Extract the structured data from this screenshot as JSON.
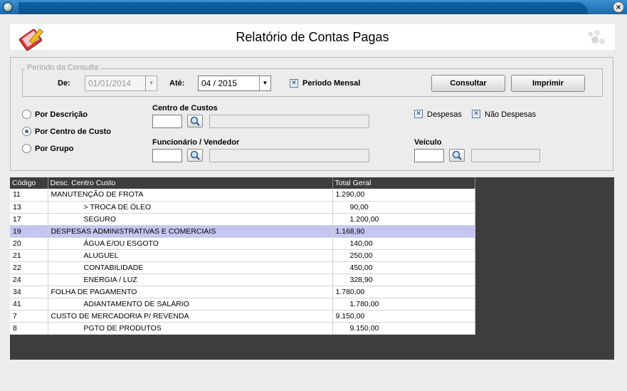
{
  "header": {
    "title": "Relatório de Contas Pagas"
  },
  "periodo": {
    "legend": "Período da Consulta",
    "de_label": "De:",
    "de_value": "01/01/2014",
    "ate_label": "Até:",
    "ate_value": "04 / 2015",
    "mensal_label": "Período Mensal",
    "consultar_label": "Consultar",
    "imprimir_label": "Imprimir"
  },
  "options": {
    "por_descricao": "Por Descrição",
    "por_centro": "Por Centro de Custo",
    "por_grupo": "Por Grupo",
    "selected": "por_centro"
  },
  "filters": {
    "centro_label": "Centro de Custos",
    "funcionario_label": "Funcionário / Vendedor",
    "despesas_label": "Despesas",
    "nao_despesas_label": "Não Despesas",
    "veiculo_label": "Veículo"
  },
  "grid": {
    "columns": [
      "Código",
      "Desc. Centro Custo",
      "Total Geral"
    ],
    "rows": [
      {
        "code": "11",
        "desc": "MANUTENÇÃO DE FROTA",
        "total": "1.290,00",
        "level": 0
      },
      {
        "code": "13",
        "desc": "> TROCA DE ÓLEO",
        "total": "90,00",
        "level": 1
      },
      {
        "code": "17",
        "desc": "SEGURO",
        "total": "1.200,00",
        "level": 1
      },
      {
        "code": "19",
        "desc": "DESPESAS ADMINISTRATIVAS E COMERCIAIS",
        "total": "1.168,90",
        "level": 0,
        "selected": true
      },
      {
        "code": "20",
        "desc": "ÁGUA E/OU ESGOTO",
        "total": "140,00",
        "level": 1
      },
      {
        "code": "21",
        "desc": "ALUGUEL",
        "total": "250,00",
        "level": 1
      },
      {
        "code": "22",
        "desc": "CONTABILIDADE",
        "total": "450,00",
        "level": 1
      },
      {
        "code": "24",
        "desc": "ENERGIA / LUZ",
        "total": "328,90",
        "level": 1
      },
      {
        "code": "34",
        "desc": "FOLHA DE PAGAMENTO",
        "total": "1.780,00",
        "level": 0
      },
      {
        "code": "41",
        "desc": "ADIANTAMENTO DE SALÁRIO",
        "total": "1.780,00",
        "level": 1
      },
      {
        "code": "7",
        "desc": "CUSTO DE MERCADORIA P/ REVENDA",
        "total": "9.150,00",
        "level": 0
      },
      {
        "code": "8",
        "desc": "PGTO DE PRODUTOS",
        "total": "9.150,00",
        "level": 1
      }
    ]
  }
}
